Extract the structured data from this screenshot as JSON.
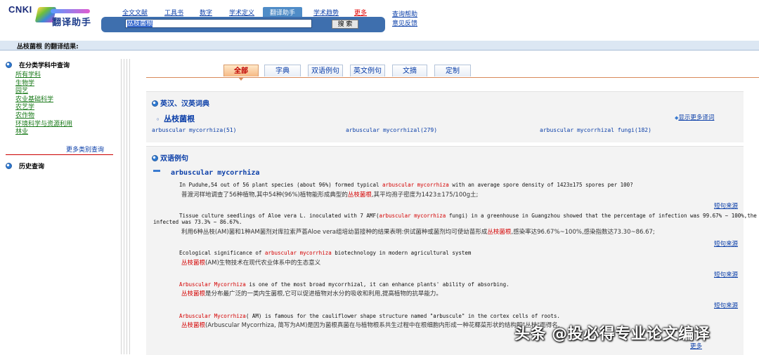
{
  "logo": {
    "brand": "CNKI",
    "product": "翻译助手"
  },
  "nav": {
    "items": [
      "全文文献",
      "工具书",
      "数字",
      "学术定义",
      "翻译助手",
      "学术趋势",
      "更多"
    ],
    "active": "翻译助手"
  },
  "search": {
    "value": "丛枝菌根",
    "button": "搜 索"
  },
  "help": {
    "query_help": "查询帮助",
    "feedback": "意见反馈"
  },
  "result_header": "丛枝菌根 的翻译结果:",
  "left": {
    "category_title": "在分类学科中查询",
    "categories": [
      "所有学科",
      "生物学",
      "园艺",
      "农业基础科学",
      "农艺学",
      "农作物",
      "环境科学与资源利用",
      "林业"
    ],
    "more_categories": "更多类别查询",
    "history_title": "历史查询"
  },
  "tabs": [
    "全部",
    "字典",
    "双语例句",
    "英文例句",
    "文摘",
    "定制"
  ],
  "dict": {
    "title": "英汉、汉英词典",
    "term": "丛枝菌根",
    "more_words": "显示更多译词",
    "translations": [
      "arbuscular mycorrhiza(51)",
      "arbuscular mycorrhizal(279)",
      "arbuscular mycorrhizal fungi(182)"
    ]
  },
  "bilingual": {
    "title": "双语例句",
    "headword": "arbuscular mycorrhiza",
    "source_label": "短句来源",
    "examples": [
      {
        "en_pre": "In Puduhe,54 out of 56 plant species (about 96%) formed typical ",
        "en_hl": "arbuscular mycorrhiza",
        "en_post": " with an average spore density of 1423±175 spores per 100?",
        "zh_pre": "普渡河样地调查了56种植物,其中54种(96%)植物能形成典型的",
        "zh_hl": "丛枝菌根",
        "zh_post": ",其平均孢子密度为1423±175/100g土;"
      },
      {
        "en_pre": "Tissue culture seedlings of Aloe vera L. inoculated with 7 AMF(",
        "en_hl": "arbuscular mycorrhiza",
        "en_post": " fungi) in a greenhouse in Guangzhou showed that the percentage of infection was 99.67% ~ 100%,the index of",
        "en_line2": "infected was 73.3% ~ 86.67%.",
        "zh_pre": "利用6种丛枝(AM)菌和1种AM菌剂对库拉索芦荟Aloe vera组培幼苗接种的结果表明:供试菌种或菌剂均可使幼苗形成",
        "zh_hl": "丛枝菌根",
        "zh_post": ",感染率达96.67%~100%,感染指数达73.30~86.67;"
      },
      {
        "en_pre": "Ecological significance of ",
        "en_hl": "arbuscular mycorrhiza",
        "en_post": " biotechnology in modern agricultural system",
        "zh_pre": "",
        "zh_hl": "丛枝菌根",
        "zh_post": "(AM)生物技术在现代农业体系中的生态意义"
      },
      {
        "en_pre": "",
        "en_hl": "Arbuscular Mycorrhiza",
        "en_post": " is one of the most broad mycorrhizal, it can enhance plants' ability of absorbing.",
        "zh_pre": "",
        "zh_hl": "丛枝菌根",
        "zh_post": "是分布最广泛的一类内生菌根,它可以促进植物对水分的吸收和利用,提高植物的抗旱能力。"
      },
      {
        "en_pre": "",
        "en_hl": "Arbuscular Mycorrhiza",
        "en_post": "( AM) is famous for the cauliflower shape structure named \"arbuscule\" in the cortex cells of roots.",
        "zh_pre": "",
        "zh_hl": "丛枝菌根",
        "zh_post": "(Arbuscular Mycorrhiza, 简写为AM)是因为菌根真菌在与植物根系共生过程中在根细胞内形成一种花椰菜形状的结构即\"丛枝\"而得名,"
      }
    ],
    "more": "更多"
  },
  "watermark": "头条 @投必得专业论文编译"
}
